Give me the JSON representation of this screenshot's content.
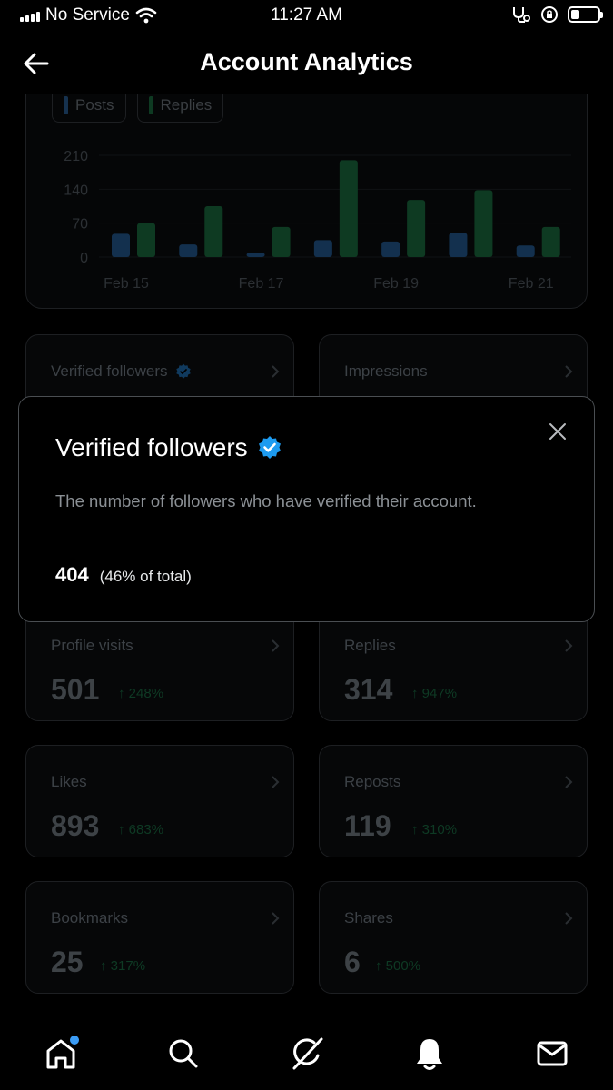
{
  "status_bar": {
    "carrier": "No Service",
    "time": "11:27 AM"
  },
  "header": {
    "title": "Account Analytics",
    "back_icon": "arrow-left-icon"
  },
  "chart": {
    "legend": [
      {
        "label": "Posts",
        "color": "#1d3a5a"
      },
      {
        "label": "Replies",
        "color": "#0f3d24"
      }
    ],
    "chart_data": {
      "type": "bar",
      "categories": [
        "Feb 15",
        "Feb 16",
        "Feb 17",
        "Feb 18",
        "Feb 19",
        "Feb 20",
        "Feb 21"
      ],
      "x_tick_labels": [
        "Feb 15",
        "Feb 17",
        "Feb 19",
        "Feb 21"
      ],
      "y_ticks": [
        "0",
        "70",
        "140",
        "210"
      ],
      "ylim": [
        0,
        230
      ],
      "series": [
        {
          "name": "Posts",
          "values": [
            48,
            26,
            9,
            35,
            32,
            50,
            24
          ]
        },
        {
          "name": "Replies",
          "values": [
            70,
            105,
            62,
            200,
            118,
            138,
            62
          ]
        }
      ]
    }
  },
  "stats": [
    {
      "label": "Verified followers",
      "value": "",
      "change": "",
      "verified": true
    },
    {
      "label": "Impressions",
      "value": "",
      "change": ""
    },
    {
      "label": "Profile visits",
      "value": "501",
      "change": "↑ 248%"
    },
    {
      "label": "Replies",
      "value": "314",
      "change": "↑ 947%"
    },
    {
      "label": "Likes",
      "value": "893",
      "change": "↑ 683%"
    },
    {
      "label": "Reposts",
      "value": "119",
      "change": "↑ 310%"
    },
    {
      "label": "Bookmarks",
      "value": "25",
      "change": "↑ 317%"
    },
    {
      "label": "Shares",
      "value": "6",
      "change": "↑ 500%"
    }
  ],
  "modal": {
    "title": "Verified followers",
    "description": "The number of followers who have verified their account.",
    "value": "404",
    "percent": "(46% of total)"
  },
  "nav": {
    "items": [
      "home-icon",
      "search-icon",
      "grok-icon",
      "notifications-icon",
      "messages-icon"
    ]
  },
  "colors": {
    "verified_badge": "#1d9bf0",
    "notification_dot": "#3b9cf5"
  }
}
